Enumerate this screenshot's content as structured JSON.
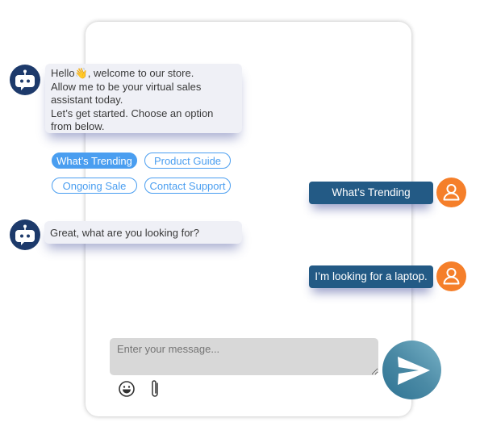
{
  "chat": {
    "bot_messages": [
      {
        "lines": [
          "Hello👋, welcome to our store.",
          "Allow me to be your virtual sales",
          "assistant today.",
          "Let’s get started. Choose an option",
          "from below."
        ]
      },
      {
        "lines": [
          "Great, what are you looking for?"
        ]
      }
    ],
    "options": [
      {
        "label": "What’s Trending",
        "selected": true
      },
      {
        "label": "Product Guide",
        "selected": false
      },
      {
        "label": "Ongoing Sale",
        "selected": false
      },
      {
        "label": "Contact Support",
        "selected": false
      }
    ],
    "user_messages": [
      {
        "text": "What’s Trending"
      },
      {
        "text": "I’m looking for a laptop."
      }
    ]
  },
  "composer": {
    "placeholder": "Enter your message...",
    "value": "",
    "tools": [
      "emoji-icon",
      "paperclip-icon"
    ],
    "send_icon": "send-icon"
  },
  "colors": {
    "bot_avatar": "#1d3a6b",
    "user_avatar": "#f57f2a",
    "user_bubble": "#235a85",
    "chip_accent": "#4a9ef0",
    "send_button": "#4b8aa5"
  }
}
